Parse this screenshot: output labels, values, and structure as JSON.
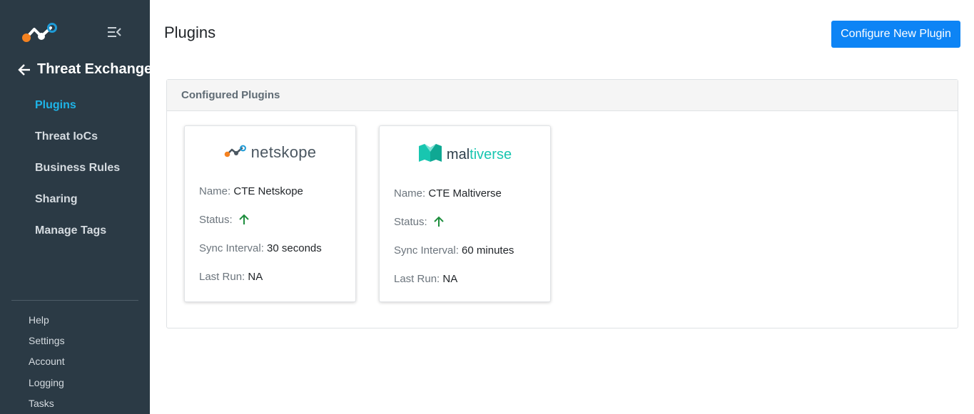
{
  "sidebar": {
    "logo_icon": "netskope-logo-icon",
    "collapse_icon": "collapse-menu-icon",
    "back_icon": "arrow-left-icon",
    "section_title": "Threat Exchange",
    "nav_items": [
      {
        "label": "Plugins",
        "active": true
      },
      {
        "label": "Threat IoCs",
        "active": false
      },
      {
        "label": "Business Rules",
        "active": false
      },
      {
        "label": "Sharing",
        "active": false
      },
      {
        "label": "Manage Tags",
        "active": false
      }
    ],
    "bottom_items": [
      {
        "label": "Help"
      },
      {
        "label": "Settings"
      },
      {
        "label": "Account"
      },
      {
        "label": "Logging"
      },
      {
        "label": "Tasks"
      }
    ]
  },
  "header": {
    "title": "Plugins",
    "configure_button": "Configure New Plugin"
  },
  "panel": {
    "title": "Configured Plugins",
    "cards": [
      {
        "brand": "netskope",
        "name_label": "Name:",
        "name_value": "CTE Netskope",
        "status_label": "Status:",
        "status_icon": "arrow-up-icon",
        "sync_label": "Sync Interval:",
        "sync_value": "30 seconds",
        "lastrun_label": "Last Run:",
        "lastrun_value": "NA"
      },
      {
        "brand_prefix": "mal",
        "brand_suffix": "tiverse",
        "name_label": "Name:",
        "name_value": "CTE Maltiverse",
        "status_label": "Status:",
        "status_icon": "arrow-up-icon",
        "sync_label": "Sync Interval:",
        "sync_value": "60 minutes",
        "lastrun_label": "Last Run:",
        "lastrun_value": "NA"
      }
    ]
  },
  "colors": {
    "sidebar_bg": "#2b3a45",
    "active_nav": "#1eb4e8",
    "primary_button": "#0d84f5",
    "status_up": "#1e8e3e",
    "netskope_orange": "#f58220",
    "netskope_blue": "#1e9ad6",
    "maltiverse_teal": "#18c6b0"
  }
}
